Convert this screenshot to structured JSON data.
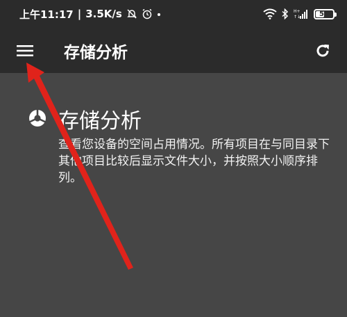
{
  "status_bar": {
    "time": "上午11:17",
    "separator": "|",
    "network_speed": "3.5K/s",
    "battery": "52",
    "battery_level": 0.52,
    "icons": [
      "mute-bell-icon",
      "alarm-icon",
      "dot-icon",
      "wifi-icon",
      "bluetooth-icon",
      "signal-icon",
      "battery-icon"
    ]
  },
  "app_bar": {
    "title": "存储分析",
    "menu_icon": "hamburger-menu-icon",
    "refresh_icon": "refresh-icon"
  },
  "card": {
    "icon": "pie-chart-icon",
    "title": "存储分析",
    "description": "查看您设备的空间占用情况。所有项目在与同目录下其他项目比较后显示文件大小，并按照大小顺序排列。"
  },
  "colors": {
    "toolbar_bg": "#2b2b2b",
    "content_bg": "#464646",
    "text": "#ffffff",
    "annotation_arrow": "#e0231b"
  }
}
